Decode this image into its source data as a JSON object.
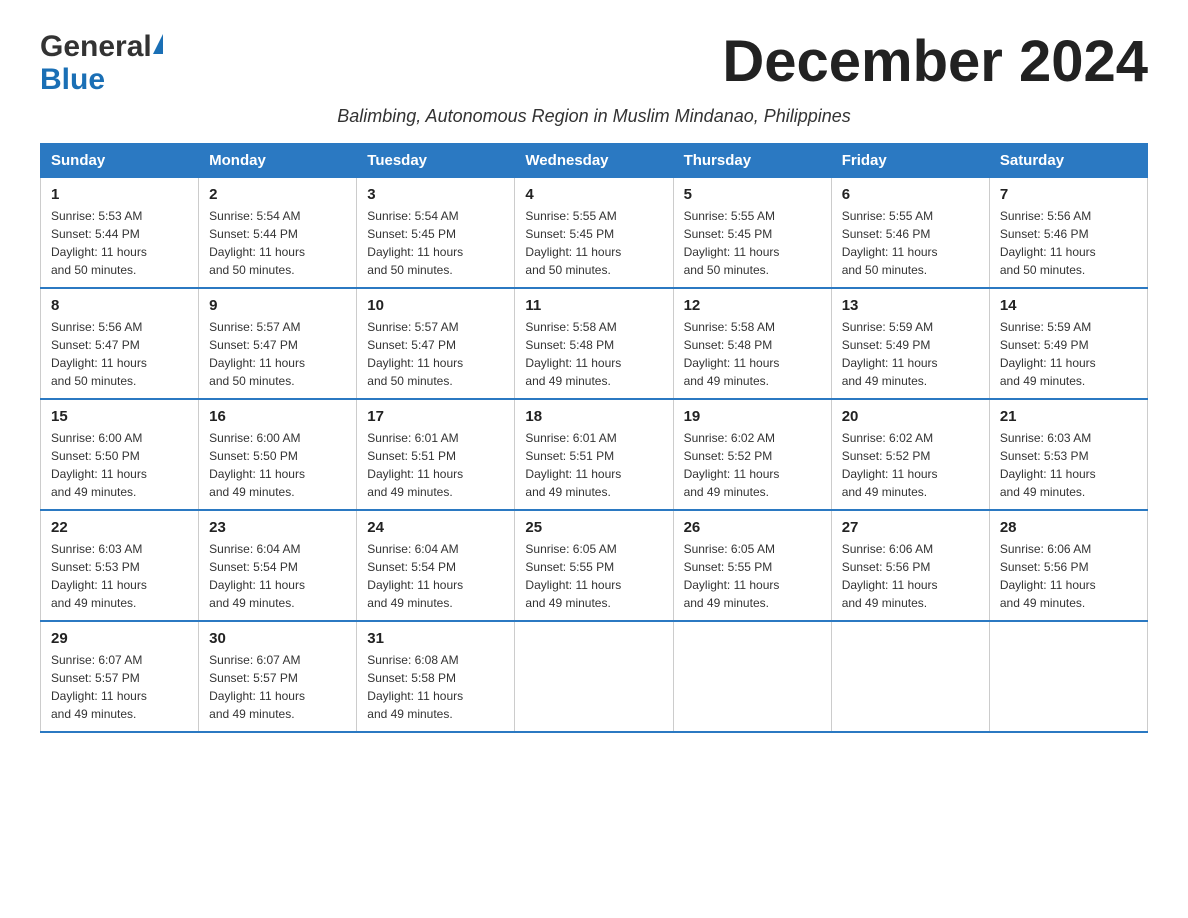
{
  "header": {
    "logo_general": "General",
    "logo_blue": "Blue",
    "month_title": "December 2024",
    "subtitle": "Balimbing, Autonomous Region in Muslim Mindanao, Philippines"
  },
  "days_of_week": [
    "Sunday",
    "Monday",
    "Tuesday",
    "Wednesday",
    "Thursday",
    "Friday",
    "Saturday"
  ],
  "weeks": [
    [
      {
        "day": "1",
        "sunrise": "5:53 AM",
        "sunset": "5:44 PM",
        "daylight": "11 hours and 50 minutes."
      },
      {
        "day": "2",
        "sunrise": "5:54 AM",
        "sunset": "5:44 PM",
        "daylight": "11 hours and 50 minutes."
      },
      {
        "day": "3",
        "sunrise": "5:54 AM",
        "sunset": "5:45 PM",
        "daylight": "11 hours and 50 minutes."
      },
      {
        "day": "4",
        "sunrise": "5:55 AM",
        "sunset": "5:45 PM",
        "daylight": "11 hours and 50 minutes."
      },
      {
        "day": "5",
        "sunrise": "5:55 AM",
        "sunset": "5:45 PM",
        "daylight": "11 hours and 50 minutes."
      },
      {
        "day": "6",
        "sunrise": "5:55 AM",
        "sunset": "5:46 PM",
        "daylight": "11 hours and 50 minutes."
      },
      {
        "day": "7",
        "sunrise": "5:56 AM",
        "sunset": "5:46 PM",
        "daylight": "11 hours and 50 minutes."
      }
    ],
    [
      {
        "day": "8",
        "sunrise": "5:56 AM",
        "sunset": "5:47 PM",
        "daylight": "11 hours and 50 minutes."
      },
      {
        "day": "9",
        "sunrise": "5:57 AM",
        "sunset": "5:47 PM",
        "daylight": "11 hours and 50 minutes."
      },
      {
        "day": "10",
        "sunrise": "5:57 AM",
        "sunset": "5:47 PM",
        "daylight": "11 hours and 50 minutes."
      },
      {
        "day": "11",
        "sunrise": "5:58 AM",
        "sunset": "5:48 PM",
        "daylight": "11 hours and 49 minutes."
      },
      {
        "day": "12",
        "sunrise": "5:58 AM",
        "sunset": "5:48 PM",
        "daylight": "11 hours and 49 minutes."
      },
      {
        "day": "13",
        "sunrise": "5:59 AM",
        "sunset": "5:49 PM",
        "daylight": "11 hours and 49 minutes."
      },
      {
        "day": "14",
        "sunrise": "5:59 AM",
        "sunset": "5:49 PM",
        "daylight": "11 hours and 49 minutes."
      }
    ],
    [
      {
        "day": "15",
        "sunrise": "6:00 AM",
        "sunset": "5:50 PM",
        "daylight": "11 hours and 49 minutes."
      },
      {
        "day": "16",
        "sunrise": "6:00 AM",
        "sunset": "5:50 PM",
        "daylight": "11 hours and 49 minutes."
      },
      {
        "day": "17",
        "sunrise": "6:01 AM",
        "sunset": "5:51 PM",
        "daylight": "11 hours and 49 minutes."
      },
      {
        "day": "18",
        "sunrise": "6:01 AM",
        "sunset": "5:51 PM",
        "daylight": "11 hours and 49 minutes."
      },
      {
        "day": "19",
        "sunrise": "6:02 AM",
        "sunset": "5:52 PM",
        "daylight": "11 hours and 49 minutes."
      },
      {
        "day": "20",
        "sunrise": "6:02 AM",
        "sunset": "5:52 PM",
        "daylight": "11 hours and 49 minutes."
      },
      {
        "day": "21",
        "sunrise": "6:03 AM",
        "sunset": "5:53 PM",
        "daylight": "11 hours and 49 minutes."
      }
    ],
    [
      {
        "day": "22",
        "sunrise": "6:03 AM",
        "sunset": "5:53 PM",
        "daylight": "11 hours and 49 minutes."
      },
      {
        "day": "23",
        "sunrise": "6:04 AM",
        "sunset": "5:54 PM",
        "daylight": "11 hours and 49 minutes."
      },
      {
        "day": "24",
        "sunrise": "6:04 AM",
        "sunset": "5:54 PM",
        "daylight": "11 hours and 49 minutes."
      },
      {
        "day": "25",
        "sunrise": "6:05 AM",
        "sunset": "5:55 PM",
        "daylight": "11 hours and 49 minutes."
      },
      {
        "day": "26",
        "sunrise": "6:05 AM",
        "sunset": "5:55 PM",
        "daylight": "11 hours and 49 minutes."
      },
      {
        "day": "27",
        "sunrise": "6:06 AM",
        "sunset": "5:56 PM",
        "daylight": "11 hours and 49 minutes."
      },
      {
        "day": "28",
        "sunrise": "6:06 AM",
        "sunset": "5:56 PM",
        "daylight": "11 hours and 49 minutes."
      }
    ],
    [
      {
        "day": "29",
        "sunrise": "6:07 AM",
        "sunset": "5:57 PM",
        "daylight": "11 hours and 49 minutes."
      },
      {
        "day": "30",
        "sunrise": "6:07 AM",
        "sunset": "5:57 PM",
        "daylight": "11 hours and 49 minutes."
      },
      {
        "day": "31",
        "sunrise": "6:08 AM",
        "sunset": "5:58 PM",
        "daylight": "11 hours and 49 minutes."
      },
      null,
      null,
      null,
      null
    ]
  ],
  "labels": {
    "sunrise_prefix": "Sunrise: ",
    "sunset_prefix": "Sunset: ",
    "daylight_prefix": "Daylight: "
  }
}
